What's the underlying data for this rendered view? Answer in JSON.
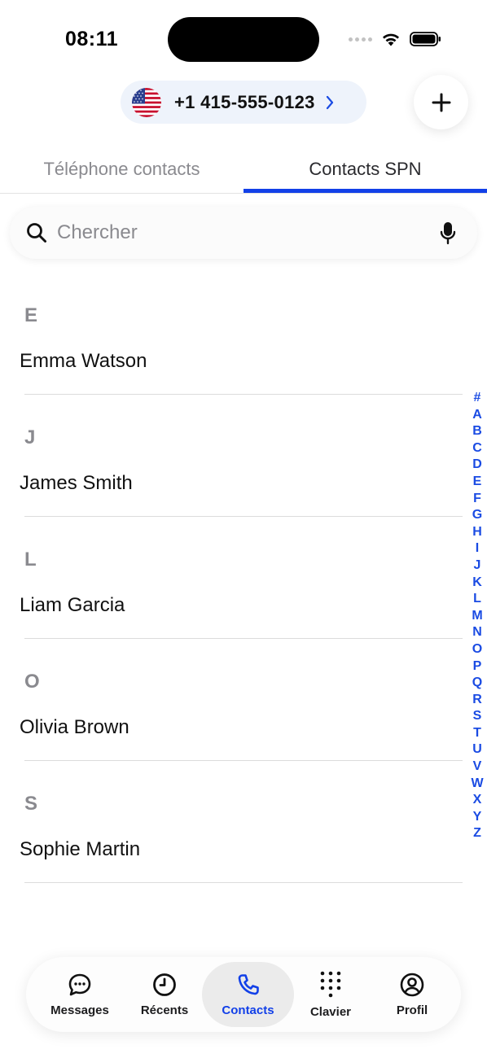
{
  "status_bar": {
    "time": "08:11"
  },
  "header": {
    "phone_number": "+1 415-555-0123",
    "flag_icon": "us-flag-icon",
    "add_icon": "plus-icon"
  },
  "tabs": [
    {
      "label": "Téléphone contacts",
      "active": false
    },
    {
      "label": "Contacts SPN",
      "active": true
    }
  ],
  "search": {
    "placeholder": "Chercher",
    "value": ""
  },
  "contacts": [
    {
      "letter": "E",
      "name": "Emma Watson"
    },
    {
      "letter": "J",
      "name": "James Smith"
    },
    {
      "letter": "L",
      "name": "Liam Garcia"
    },
    {
      "letter": "O",
      "name": "Olivia Brown"
    },
    {
      "letter": "S",
      "name": "Sophie Martin"
    }
  ],
  "alphabet_index": [
    "#",
    "A",
    "B",
    "C",
    "D",
    "E",
    "F",
    "G",
    "H",
    "I",
    "J",
    "K",
    "L",
    "M",
    "N",
    "O",
    "P",
    "Q",
    "R",
    "S",
    "T",
    "U",
    "V",
    "W",
    "X",
    "Y",
    "Z"
  ],
  "bottom_nav": [
    {
      "label": "Messages",
      "icon": "chat-bubble-icon",
      "active": false
    },
    {
      "label": "Récents",
      "icon": "clock-icon",
      "active": false
    },
    {
      "label": "Contacts",
      "icon": "phone-icon",
      "active": true
    },
    {
      "label": "Clavier",
      "icon": "keypad-icon",
      "active": false
    },
    {
      "label": "Profil",
      "icon": "profile-icon",
      "active": false
    }
  ],
  "colors": {
    "accent": "#1240e8",
    "index_letters": "#1a4be3",
    "muted_text": "#8a8a8f",
    "phone_pill_bg": "#eef3fb"
  }
}
